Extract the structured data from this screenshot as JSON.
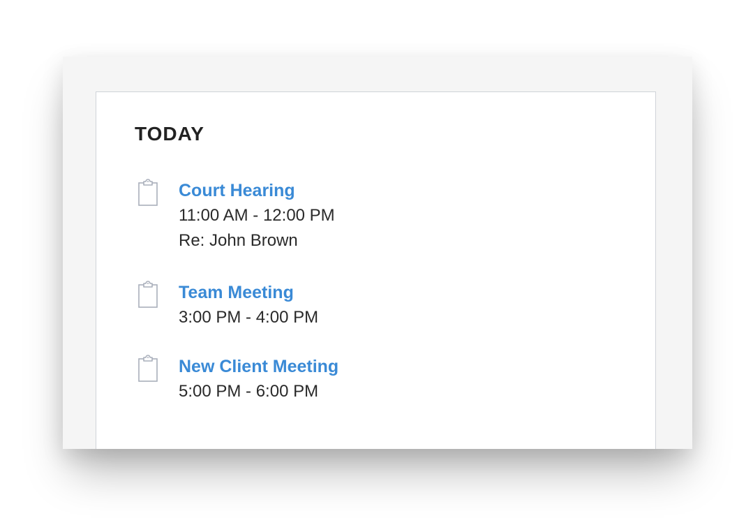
{
  "heading": "TODAY",
  "colors": {
    "link": "#3a8ad6",
    "text": "#2a2a2a",
    "icon": "#a9afbb"
  },
  "events": [
    {
      "icon": "clipboard-icon",
      "title": "Court Hearing",
      "time": "11:00 AM - 12:00 PM",
      "note": "Re: John Brown"
    },
    {
      "icon": "clipboard-icon",
      "title": "Team Meeting",
      "time": "3:00 PM - 4:00 PM"
    },
    {
      "icon": "clipboard-icon",
      "title": "New Client Meeting",
      "time": "5:00 PM - 6:00 PM"
    }
  ]
}
